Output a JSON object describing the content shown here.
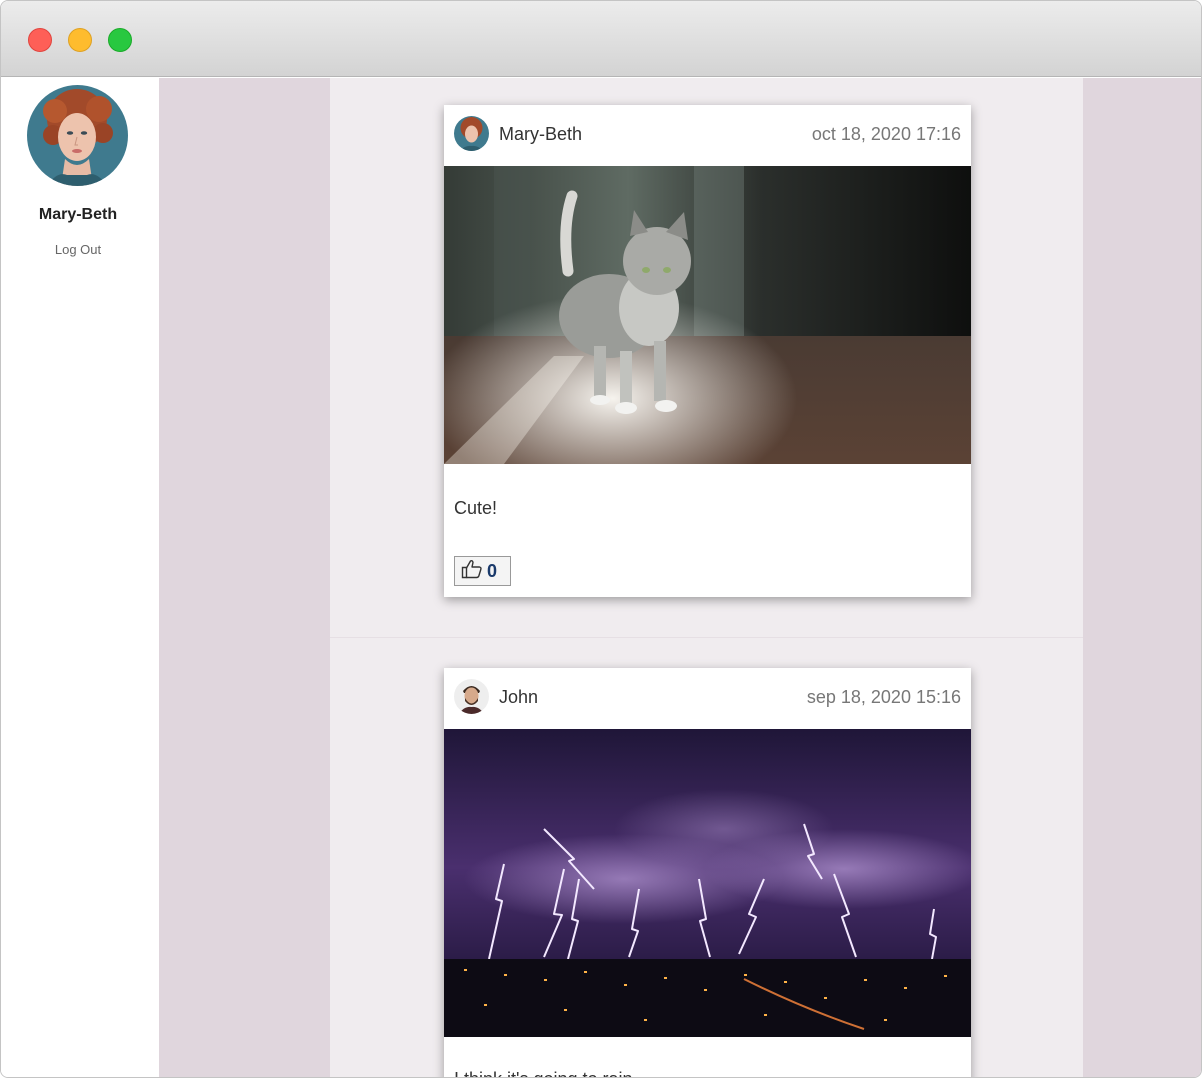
{
  "sidebar": {
    "profile_name": "Mary-Beth",
    "logout_label": "Log Out"
  },
  "posts": [
    {
      "author": "Mary-Beth",
      "timestamp": "oct 18, 2020 17:16",
      "photo_subject": "kitten",
      "caption": "Cute!",
      "likes": "0",
      "like_icon": "thumbs-up-icon"
    },
    {
      "author": "John",
      "timestamp": "sep 18, 2020 15:16",
      "photo_subject": "lightning-storm-over-city",
      "caption": "I think it's going to rain"
    }
  ],
  "colors": {
    "gutter": "#e0d6dd",
    "feed_background": "#f0ecef",
    "like_count": "#1a3a6b"
  }
}
